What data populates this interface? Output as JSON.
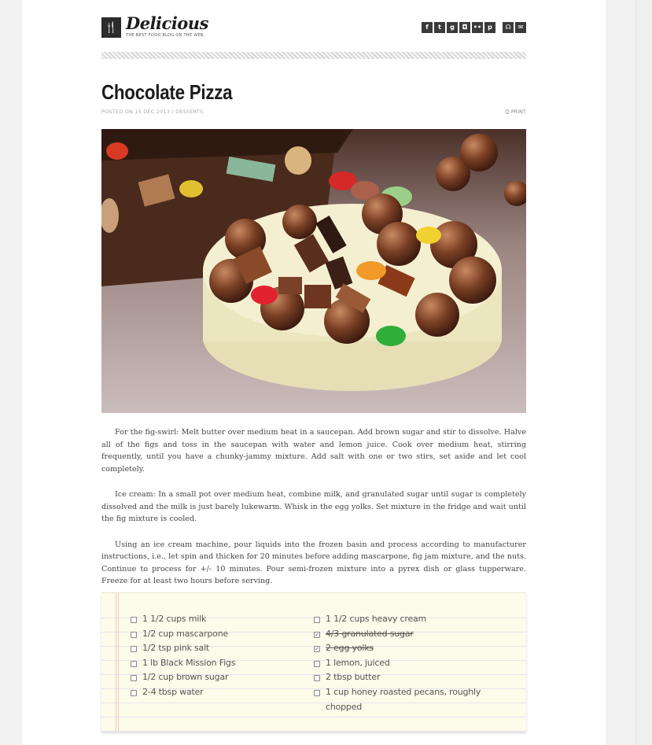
{
  "site": {
    "logo_glyph": "🍴",
    "brand": "Delicious",
    "tagline": "The best food blog on the web.",
    "social_icons": [
      {
        "icon": "facebook-icon",
        "glyph": "f"
      },
      {
        "icon": "twitter-icon",
        "glyph": "t"
      },
      {
        "icon": "google-plus-icon",
        "glyph": "g"
      },
      {
        "icon": "instagram-icon",
        "glyph": "◘"
      },
      {
        "icon": "flickr-icon",
        "glyph": "••"
      },
      {
        "icon": "pinterest-icon",
        "glyph": "p"
      }
    ],
    "contact_icons": [
      {
        "icon": "rss-icon",
        "glyph": "☊"
      },
      {
        "icon": "email-icon",
        "glyph": "✉"
      }
    ]
  },
  "post": {
    "title": "Chocolate Pizza",
    "meta": "Posted on 15 Dec 2013 / Desserts",
    "print_label": "Print",
    "print_icon": "printer-icon",
    "paragraphs": [
      "For the fig-swirl: Melt butter over medium heat in a saucepan. Add brown sugar and stir to dissolve. Halve all of the figs and toss in the saucepan with water and lemon juice. Cook over medium heat, stirring frequently, until you have a chunky-jammy mixture. Add salt with one or two stirs, set aside and let cool completely.",
      "Ice cream: In a small pot over medium heat, combine milk, and granulated sugar until sugar is completely dissolved and the milk is just barely lukewarm. Whisk in the egg yolks. Set mixture in the fridge and wait until the fig mixture is cooled.",
      "Using an ice cream machine, pour liquids into the frozen basin and process according to manufacturer instructions, i.e., let spin and thicken for 20 minutes before adding mascarpone, fig jam mixture, and the nuts. Continue to process for +/- 10 minutes. Pour semi-frozen mixture into a pyrex dish or glass tupperware. Freeze for at least two hours before serving."
    ]
  },
  "ingredients": {
    "left": [
      {
        "label": "1 1/2 cups milk",
        "checked": false
      },
      {
        "label": "1/2 cup mascarpone",
        "checked": false
      },
      {
        "label": "1/2 tsp pink salt",
        "checked": false
      },
      {
        "label": "1 lb Black Mission Figs",
        "checked": false
      },
      {
        "label": "1/2 cup brown sugar",
        "checked": false
      },
      {
        "label": "2-4 tbsp water",
        "checked": false
      }
    ],
    "right": [
      {
        "label": "1 1/2 cups heavy cream",
        "checked": false
      },
      {
        "label": "4/3 granulated sugar",
        "checked": true
      },
      {
        "label": "2 egg yolks",
        "checked": true
      },
      {
        "label": "1 lemon, juiced",
        "checked": false
      },
      {
        "label": "2 tbsp butter",
        "checked": false
      },
      {
        "label": "1 cup honey roasted pecans, roughly chopped",
        "checked": false
      }
    ]
  }
}
